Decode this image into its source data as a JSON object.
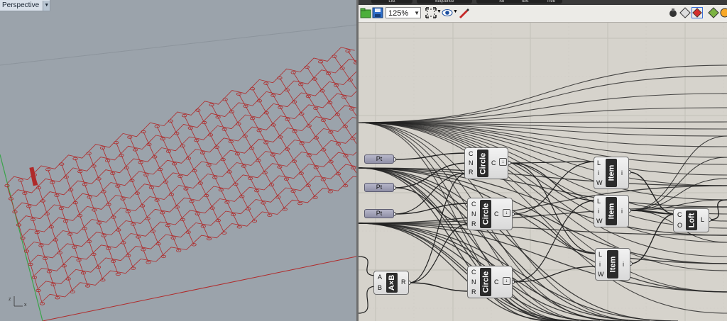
{
  "viewport": {
    "name": "Perspective",
    "axis_z": "z",
    "axis_x": "x"
  },
  "toolbar": {
    "zoom": "125%",
    "tabs": [
      "List",
      "Sequence",
      "Sets",
      "Text",
      "Tree"
    ]
  },
  "components": {
    "pt_label": "Pt",
    "circle": {
      "name": "Circle",
      "inputs": [
        "C",
        "N",
        "R"
      ],
      "output": "C"
    },
    "item": {
      "name": "Item",
      "inputs": [
        "L",
        "i",
        "W"
      ],
      "output": "i"
    },
    "loft": {
      "name": "Loft",
      "inputs": [
        "C",
        "O"
      ],
      "output": "L"
    },
    "multiply": {
      "name": "A×B",
      "inputs": [
        "A",
        "B"
      ],
      "output": "R"
    }
  },
  "colors": {
    "viewport_bg": "#9ba3ab",
    "geometry": "#b02a2a",
    "canvas_bg": "#d6d3cc",
    "wire": "#222222"
  }
}
